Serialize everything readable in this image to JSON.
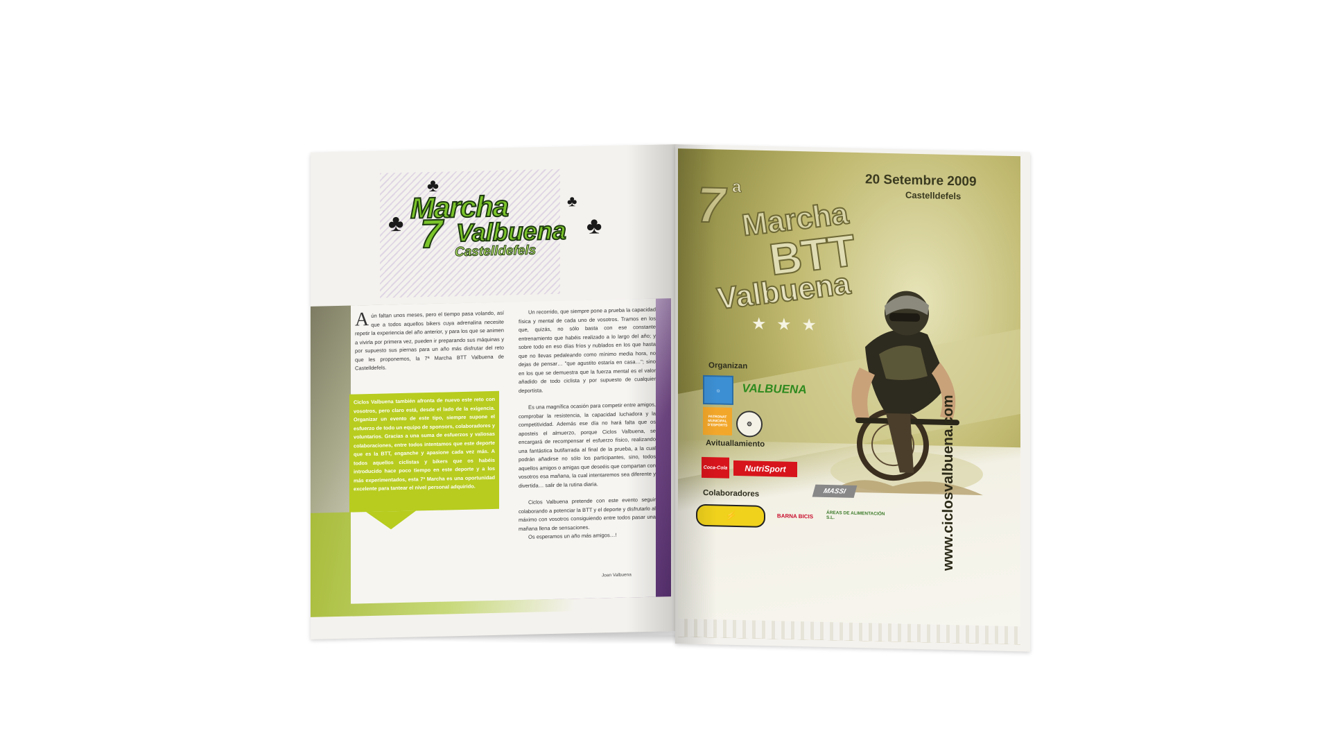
{
  "left_page": {
    "title": {
      "line1": "Marcha",
      "number": "7",
      "superscript": "a",
      "line2": "Valbuena",
      "line3": "Castelldefels"
    },
    "intro_dropcap": "A",
    "intro_text": "ún faltan unos meses, pero el tiempo pasa volando, así que a todos aquellos bikers cuya adrenalina necesite repetir la experiencia del año anterior, y para los que se animen a vivirla por primera vez, pueden ir preparando sus máquinas y por supuesto sus piernas para un año más disfrutar del reto que les proponemos, la 7ª Marcha BTT Valbuena de Castelldefels.",
    "callout_text": "Ciclos Valbuena también afronta de nuevo este reto con vosotros, pero claro está, desde el lado de la exigencia. Organizar un evento de este tipo, siempre supone el esfuerzo de todo un equipo de sponsors, colaboradores y voluntarios. Gracias a una suma de esfuerzos y valiosas colaboraciones, entre todos intentamos que este deporte que es la BTT, enganche y apasione cada vez más. A todos aquellos ciclistas y bikers que os habéis introducido hace poco tiempo en este deporte y a los más experimentados, esta 7ª Marcha es una oportunidad excelente para tantear el nivel personal adquirido.",
    "col2_p1": "Un recorrido, que siempre pone a prueba la capacidad física y mental de cada uno de vosotros. Tramos en los que, quizás, no sólo basta con ese constante entrenamiento que habéis realizado a lo largo del año; y sobre todo en eso días fríos y nublados en los que hasta que no llevas pedaleando como mínimo media hora, no dejas de pensar… \"que agustito estaría en casa…\"; sino en los que se demuestra que la fuerza mental es el valor añadido de todo ciclista y por supuesto de cualquier deportista.",
    "col2_p2": "Es una magnífica ocasión para competir entre amigos, comprobar la resistencia, la capacidad luchadora y la competitividad. Además ese día no hará falta que os aposteis el almuerzo, porque Ciclos Valbuena, se encargará de recompensar el esfuerzo físico, realizando una fantástica butifarrada al final de la prueba, a la cual podrán añadirse no sólo los participantes, sino, todos aquellos amigos o amigas que deseéis que compartan con vosotros esa mañana, la cual intentaremos sea diferente y divertida… salir de la rutina diaria.",
    "col2_p3": "Ciclos Valbuena pretende con este evento seguir colaborando a potenciar la BTT y el deporte y disfrutarlo al máximo con vosotros consiguiendo entre todos pasar una mañana llena de sensaciones.",
    "col2_p4": "Os esperamos un año más amigos…!",
    "signature": "Joan Valbuena"
  },
  "right_page": {
    "date": "20 Setembre 2009",
    "city": "Castelldefels",
    "title_number": "7",
    "title_super": "a",
    "title_marcha": "Marcha",
    "title_btt": "BTT",
    "title_valbuena": "Valbuena",
    "stars": "★ ★ ★",
    "url": "www.ciclosvalbuena.com",
    "organizan_label": "Organizan",
    "avituallamiento_label": "Avituallamiento",
    "colaboradores_label": "Colaboradores",
    "logos": {
      "valbuena": "VALBUENA",
      "patronat": "PATRONAT MUNICIPAL D'ESPORTS",
      "cocacola": "Coca-Cola",
      "nutrisport": "NutriSport",
      "massi": "MASSI",
      "barna": "BARNA BICIS",
      "areas": "ÁREAS DE ALIMENTACIÓN S.L."
    }
  },
  "colors": {
    "accent_lime": "#b7cc1f",
    "title_green": "#7cc52a",
    "poster_olive": "#bfb86e",
    "purple": "#6a3c85"
  }
}
